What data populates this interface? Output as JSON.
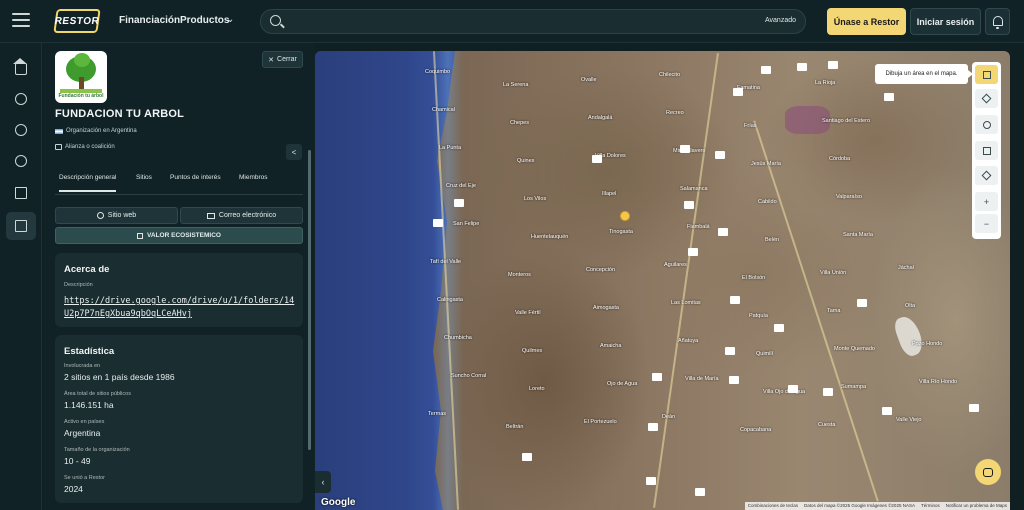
{
  "topbar": {
    "logo": "RESTOR",
    "nav": [
      "Financiación",
      "Productos"
    ],
    "search": {
      "value": "",
      "placeholder": "",
      "advanced_label": "Avanzado"
    },
    "join_label": "Únase a Restor",
    "login_label": "Iniciar sesión",
    "icons": {
      "menu": "hamburger-icon",
      "search": "search-icon",
      "bell": "bell-icon"
    }
  },
  "rail": {
    "items": [
      "home-icon",
      "users-icon",
      "location-icon",
      "globe-icon",
      "book-icon",
      "projects-icon"
    ],
    "active_index": 5
  },
  "panel": {
    "logo_text": "Fundación tu árbol",
    "close_label": "Cerrar",
    "org_name": "FUNDACION TU ARBOL",
    "country": "Organización en Argentina",
    "type": "Alianza o coalición",
    "tabs": [
      "Descripción general",
      "Sitios",
      "Puntos de interés",
      "Miembros"
    ],
    "active_tab": 0,
    "website_label": "Sitio web",
    "email_label": "Correo electrónico",
    "value_label": "VALOR ECOSISTEMICO",
    "about": {
      "title": "Acerca de",
      "desc_label": "Descripción",
      "link": "https://drive.google.com/drive/u/1/folders/14U2p7P7nEgXbua9qbOqLCeAHvj"
    },
    "stats": {
      "title": "Estadística",
      "items": [
        {
          "label": "Involucrada en",
          "value": "2 sitios en 1 país desde 1986"
        },
        {
          "label": "Área total de sitios públicos",
          "value": "1.146.151 ha"
        },
        {
          "label": "Activo en países",
          "value": "Argentina"
        },
        {
          "label": "Tamaño de la organización",
          "value": "10 - 49"
        },
        {
          "label": "Se unió a Restor",
          "value": "2024"
        }
      ]
    }
  },
  "map": {
    "draw_tip": "Dibuja un área en el mapa.",
    "tools": [
      "draw-area-icon",
      "layers-icon",
      "target-icon",
      "fullscreen-icon",
      "locate-icon",
      "zoom-in-icon",
      "zoom-out-icon"
    ],
    "google": "Google",
    "attribution": [
      "Combinaciones de teclas",
      "Datos del mapa ©2025 Google Imágenes ©2025 NASA",
      "Términos",
      "Notificar un problema de Maps"
    ],
    "cities": [
      "Coquimbo",
      "La Serena",
      "Ovalle",
      "Chilecito",
      "Famatina",
      "La Rioja",
      "Catamarca",
      "Chamical",
      "Chepes",
      "Andalgalá",
      "Recreo",
      "Frías",
      "Santiago del Estero",
      "San Juan",
      "La Punta",
      "Quines",
      "Villa Dolores",
      "Mina Clavero",
      "Jesús María",
      "Córdoba",
      "Deán Funes",
      "Cruz del Eje",
      "Los Vilos",
      "Illapel",
      "Salamanca",
      "Cabildo",
      "Valparaíso",
      "Quilpué",
      "San Felipe",
      "Huentelauquén",
      "Tinogasta",
      "Fiambalá",
      "Belén",
      "Santa María",
      "Cafayate",
      "Tafí del Valle",
      "Monteros",
      "Concepción",
      "Aguilares",
      "El Bolsón",
      "Villa Unión",
      "Jáchal",
      "Calingasta",
      "Valle Fértil",
      "Aimogasta",
      "Las Lomitas",
      "Patquía",
      "Tama",
      "Olta",
      "Chumbicha",
      "Quilmes",
      "Amaicha",
      "Añatuya",
      "Quimilí",
      "Monte Quemado",
      "Pozo Hondo",
      "Suncho Corral",
      "Loreto",
      "Ojo de Agua",
      "Villa de María",
      "Villa Ojo de Agua",
      "Sumampa",
      "Villa Río Hondo",
      "Termas",
      "Beltrán",
      "El Portezuelo",
      "Deán",
      "Copacabana",
      "Cuesta",
      "Valle Viejo"
    ]
  }
}
